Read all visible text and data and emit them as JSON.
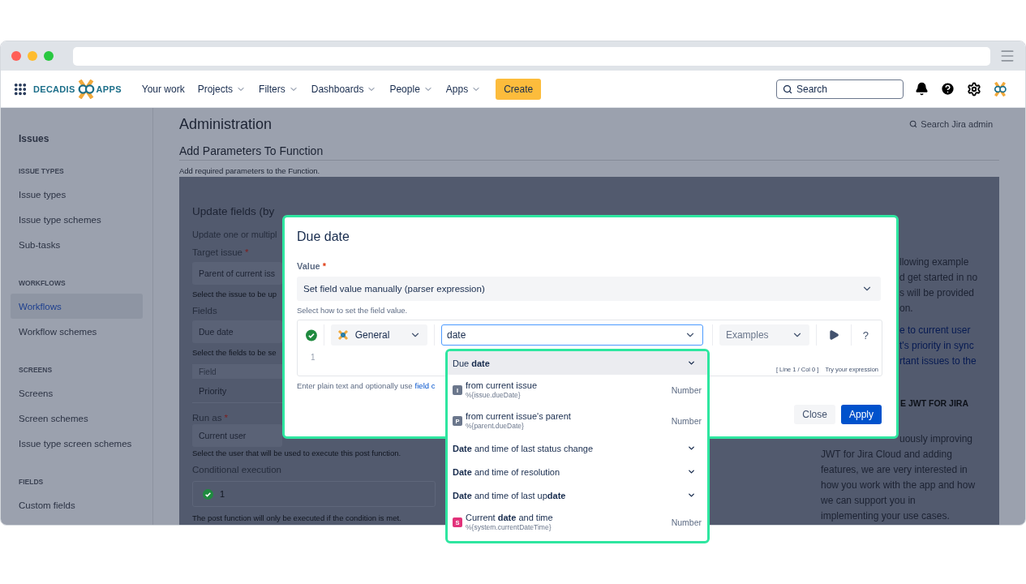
{
  "nav": {
    "logo": [
      "DECADIS",
      "APPS"
    ],
    "items": [
      {
        "label": "Your work",
        "dropdown": false
      },
      {
        "label": "Projects",
        "dropdown": true
      },
      {
        "label": "Filters",
        "dropdown": true
      },
      {
        "label": "Dashboards",
        "dropdown": true
      },
      {
        "label": "People",
        "dropdown": true
      },
      {
        "label": "Apps",
        "dropdown": true
      }
    ],
    "create": "Create",
    "search": {
      "placeholder": "Search"
    }
  },
  "sidebar": {
    "top": "Issues",
    "sections": [
      {
        "heading": "ISSUE TYPES",
        "items": [
          {
            "label": "Issue types",
            "selected": false
          },
          {
            "label": "Issue type schemes",
            "selected": false
          },
          {
            "label": "Sub-tasks",
            "selected": false
          }
        ]
      },
      {
        "heading": "WORKFLOWS",
        "items": [
          {
            "label": "Workflows",
            "selected": true
          },
          {
            "label": "Workflow schemes",
            "selected": false
          }
        ]
      },
      {
        "heading": "SCREENS",
        "items": [
          {
            "label": "Screens",
            "selected": false
          },
          {
            "label": "Screen schemes",
            "selected": false
          },
          {
            "label": "Issue type screen schemes",
            "selected": false
          }
        ]
      },
      {
        "heading": "FIELDS",
        "items": [
          {
            "label": "Custom fields",
            "selected": false
          }
        ]
      }
    ]
  },
  "page": {
    "title": "Administration",
    "admin_search": "Search Jira admin",
    "subtitle": "Add Parameters To Function",
    "description": "Add required parameters to the Function."
  },
  "function_panel": {
    "title": "Update fields (by",
    "intro": "Update one or multipl",
    "target_issue": {
      "label": "Target issue",
      "marker": "*",
      "value": "Parent of current iss",
      "help": "Select the issue to be up"
    },
    "fields": {
      "label": "Fields",
      "value": "Due date",
      "help": "Select the fields to be se",
      "table_header": "Field",
      "rows": [
        "Priority"
      ]
    },
    "run_as": {
      "label": "Run as",
      "marker": "*",
      "value": "Current user",
      "help": "Select the user that will be used to execute this post function."
    },
    "conditional": {
      "label": "Conditional execution",
      "valid": true,
      "line": "1",
      "help": "The post function will only be executed if the condition is met."
    }
  },
  "right_panel": {
    "cut_lines": [
      "llowing example",
      "d get started in no",
      "s will be provided",
      "on."
    ],
    "link_lines": [
      "e to current user",
      "t's priority in sync",
      "rtant issues to the"
    ],
    "heading": "E JWT FOR JIRA",
    "cut_tail": "uously improving",
    "lines": [
      "JWT for Jira Cloud and adding",
      "features, we are very interested in",
      "how you work with the app and how",
      "we can support you in",
      "implementing your use cases."
    ]
  },
  "modal": {
    "title": "Due date",
    "value_label": "Value",
    "marker": "*",
    "mode": "Set field value manually (parser expression)",
    "mode_help": "Select how to set the field value.",
    "editor": {
      "valid": true,
      "category": "General",
      "search": "date",
      "examples": "Examples",
      "help": "?",
      "line_number": "1",
      "position": "[ Line 1 / Col 0 ]",
      "try": "Try your expression"
    },
    "hint": "Enter plain text and optionally use",
    "hint_link": "field c",
    "buttons": [
      {
        "label": "Close",
        "primary": false
      },
      {
        "label": "Apply",
        "primary": true
      }
    ]
  },
  "dropdown": {
    "items": [
      {
        "kind": "group",
        "label": "Due **date**",
        "selected": true
      },
      {
        "kind": "field",
        "badge": "I",
        "color": "#6b778c",
        "label": "from current issue",
        "path": "%{issue.dueDate}",
        "type": "Number",
        "selected": false
      },
      {
        "kind": "field",
        "badge": "P",
        "color": "#6b778c",
        "label": "from current issue's parent",
        "path": "%{parent.dueDate}",
        "type": "Number",
        "selected": false
      },
      {
        "kind": "group",
        "label": "**Date** and time of last status change",
        "selected": false
      },
      {
        "kind": "group",
        "label": "**Date** and time of resolution",
        "selected": false
      },
      {
        "kind": "group",
        "label": "**Date** and time of last up**date**",
        "selected": false
      },
      {
        "kind": "field",
        "badge": "S",
        "color": "#e2327a",
        "label": "Current **date** and time",
        "path": "%{system.currentDateTime}",
        "type": "Number",
        "selected": false
      }
    ]
  }
}
